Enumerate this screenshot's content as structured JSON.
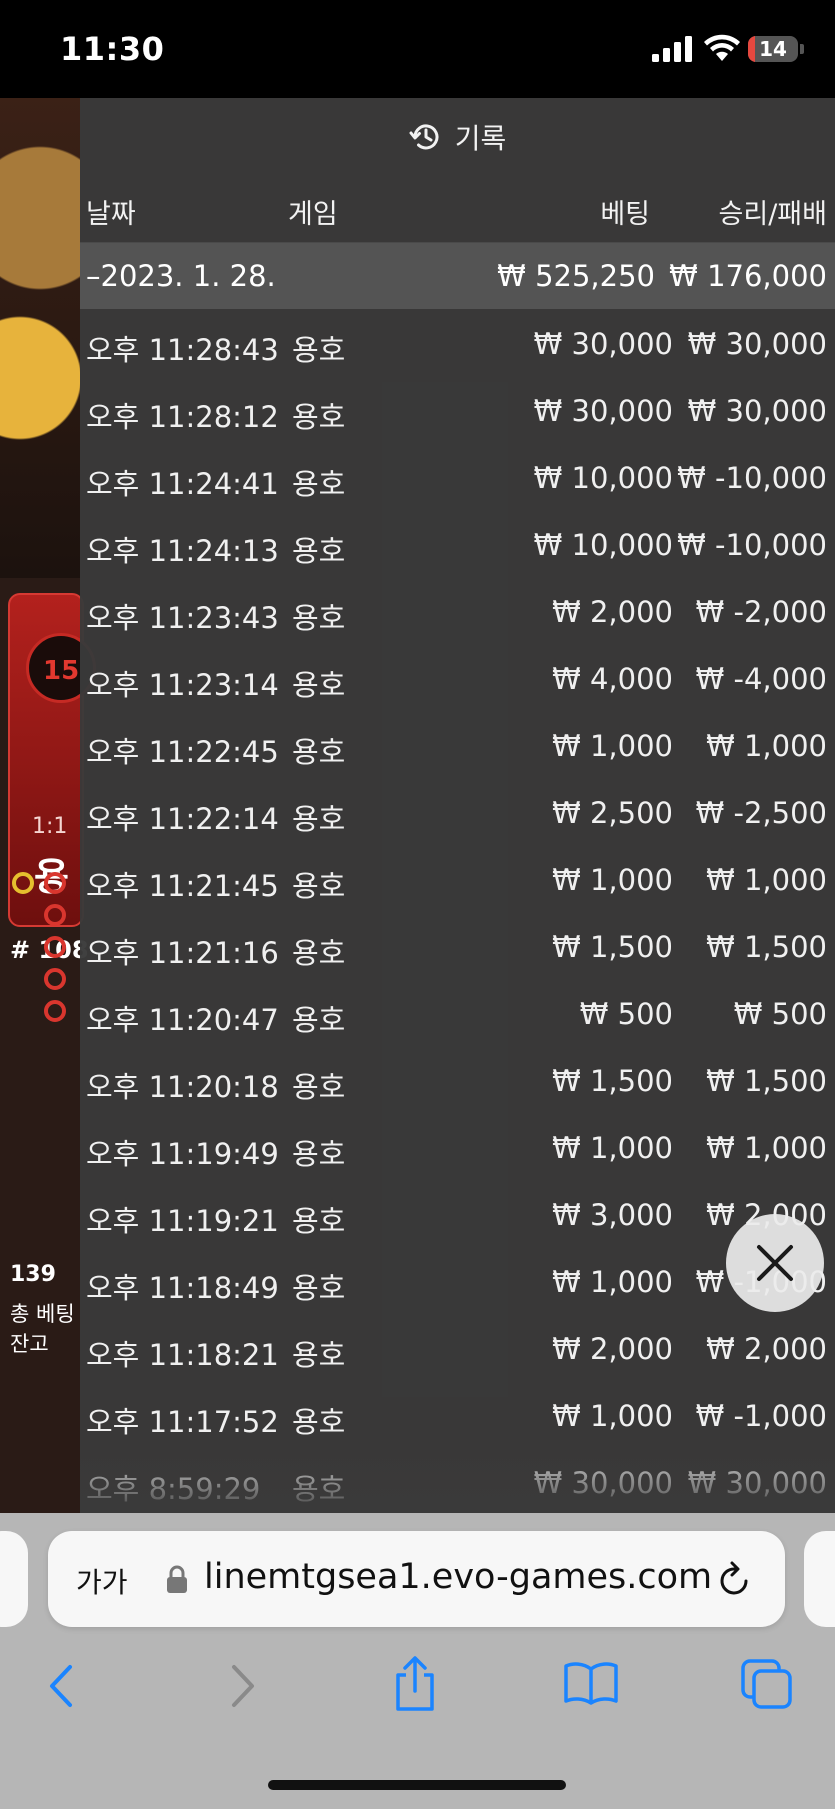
{
  "status": {
    "time": "11:30",
    "battery": "14",
    "battery_level_percent": 14
  },
  "background": {
    "odds": "1:1",
    "dragon": "용",
    "percent": "15",
    "round": "# 108",
    "players": "139",
    "total_bet_label": "총 베팅",
    "balance_label": "잔고"
  },
  "panel": {
    "title": "기록",
    "columns": {
      "date": "날짜",
      "game": "게임",
      "bet": "베팅",
      "result": "승리/패배"
    },
    "date_group": {
      "date": "–2023. 1. 28.",
      "bet": "₩ 525,250",
      "result": "₩ 176,000"
    },
    "rows": [
      {
        "time": "오후 11:28:43",
        "game": "용호",
        "bet": "₩ 30,000",
        "result": "₩ 30,000"
      },
      {
        "time": "오후 11:28:12",
        "game": "용호",
        "bet": "₩ 30,000",
        "result": "₩ 30,000"
      },
      {
        "time": "오후 11:24:41",
        "game": "용호",
        "bet": "₩ 10,000",
        "result": "₩ -10,000"
      },
      {
        "time": "오후 11:24:13",
        "game": "용호",
        "bet": "₩ 10,000",
        "result": "₩ -10,000"
      },
      {
        "time": "오후 11:23:43",
        "game": "용호",
        "bet": "₩ 2,000",
        "result": "₩ -2,000"
      },
      {
        "time": "오후 11:23:14",
        "game": "용호",
        "bet": "₩ 4,000",
        "result": "₩ -4,000"
      },
      {
        "time": "오후 11:22:45",
        "game": "용호",
        "bet": "₩ 1,000",
        "result": "₩ 1,000"
      },
      {
        "time": "오후 11:22:14",
        "game": "용호",
        "bet": "₩ 2,500",
        "result": "₩ -2,500"
      },
      {
        "time": "오후 11:21:45",
        "game": "용호",
        "bet": "₩ 1,000",
        "result": "₩ 1,000"
      },
      {
        "time": "오후 11:21:16",
        "game": "용호",
        "bet": "₩ 1,500",
        "result": "₩ 1,500"
      },
      {
        "time": "오후 11:20:47",
        "game": "용호",
        "bet": "₩ 500",
        "result": "₩ 500"
      },
      {
        "time": "오후 11:20:18",
        "game": "용호",
        "bet": "₩ 1,500",
        "result": "₩ 1,500"
      },
      {
        "time": "오후 11:19:49",
        "game": "용호",
        "bet": "₩ 1,000",
        "result": "₩ 1,000"
      },
      {
        "time": "오후 11:19:21",
        "game": "용호",
        "bet": "₩ 3,000",
        "result": "₩ 2,000"
      },
      {
        "time": "오후 11:18:49",
        "game": "용호",
        "bet": "₩ 1,000",
        "result": "₩ -1,000"
      },
      {
        "time": "오후 11:18:21",
        "game": "용호",
        "bet": "₩ 2,000",
        "result": "₩ 2,000"
      },
      {
        "time": "오후 11:17:52",
        "game": "용호",
        "bet": "₩ 1,000",
        "result": "₩ -1,000"
      },
      {
        "time": "오후 8:59:29",
        "game": "용호",
        "bet": "₩ 30,000",
        "result": "₩ 30,000"
      }
    ]
  },
  "safari": {
    "text_size": "가가",
    "url": "linemtgsea1.evo-games.com"
  },
  "icons": {
    "history": "history-icon",
    "close": "close-icon",
    "lock": "lock-icon",
    "reload": "reload-icon",
    "back": "back-icon",
    "forward": "forward-icon",
    "share": "share-icon",
    "bookmarks": "bookmarks-icon",
    "tabs": "tabs-icon"
  },
  "colors": {
    "panel": "#3a3a3a",
    "safari_blue": "#1a84ff",
    "dragon_red": "#c62a24"
  }
}
